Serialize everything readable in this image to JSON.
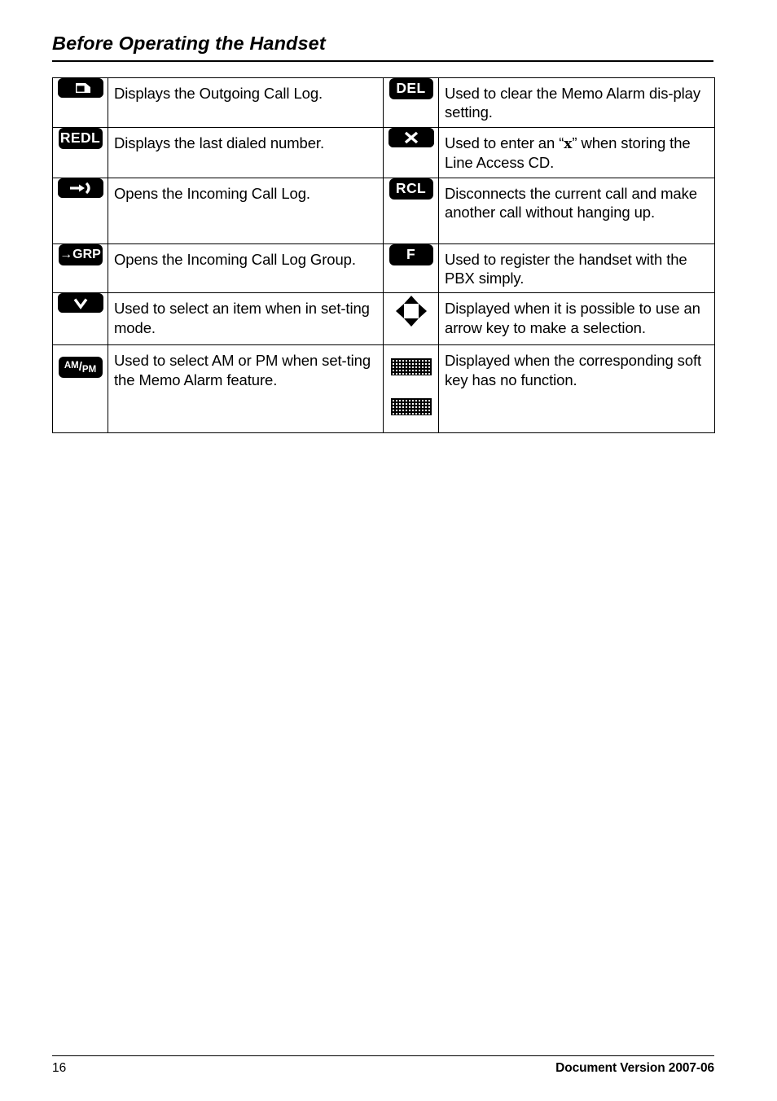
{
  "page": {
    "title": "Before Operating the Handset",
    "footer_page_number": "16",
    "footer_document_version": "Document Version 2007-06"
  },
  "table": {
    "rows": [
      {
        "left_icon": "outgoing-call-key",
        "left_icon_label": "",
        "left_desc": "Displays the Outgoing Call Log.",
        "right_icon": "del-key",
        "right_icon_label": "DEL",
        "right_desc": "Used to clear the Memo Alarm dis-play setting."
      },
      {
        "left_icon": "redial-key",
        "left_icon_label": "REDL",
        "left_desc": "Displays the last dialed number.",
        "right_icon": "x-key",
        "right_icon_label": "X",
        "right_desc_pre": "Used to enter an “",
        "right_desc_x": "x",
        "right_desc_post": "” when storing the Line Access CD."
      },
      {
        "left_icon": "incoming-call-key",
        "left_icon_label": "",
        "left_desc": "Opens the Incoming Call Log.",
        "right_icon": "rcl-key",
        "right_icon_label": "RCL",
        "right_desc": "Disconnects the current call and make another call without hanging up."
      },
      {
        "left_icon": "incoming-call-group-key",
        "left_icon_label": "→GRP",
        "left_desc": "Opens the Incoming Call Log Group.",
        "right_icon": "f-key",
        "right_icon_label": "F",
        "right_desc": "Used to register the handset with the PBX simply."
      },
      {
        "left_icon": "down-select-key",
        "left_icon_label": "∨",
        "left_desc": "Used to select an item when in set-ting mode.",
        "right_icon": "navigation-arrows-indicator",
        "right_icon_label": "",
        "right_desc": "Displayed when it is possible to use an arrow key to make a selection."
      },
      {
        "left_icon": "am-pm-key",
        "left_icon_label_am": "AM",
        "left_icon_label_slash": "/",
        "left_icon_label_pm": "PM",
        "left_desc": "Used to select AM or PM when set-ting the Memo Alarm feature.",
        "right_icon": "blank-soft-key-indicator",
        "right_icon_label": "",
        "right_desc": "Displayed when the corresponding soft key has no function."
      }
    ]
  }
}
